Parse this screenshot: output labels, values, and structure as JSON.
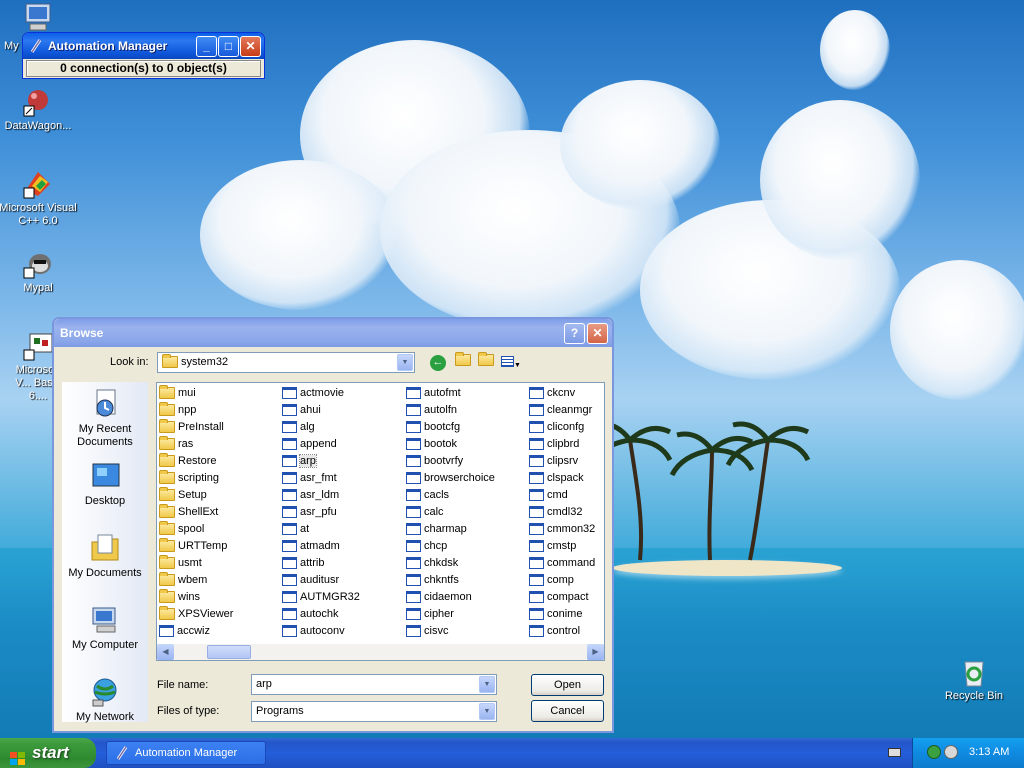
{
  "desktop": {
    "icons": [
      {
        "label": "My",
        "icon": "computer-icon"
      },
      {
        "label": "DataWagon...",
        "icon": "datawagon-icon"
      },
      {
        "label": "Microsoft Visual C++ 6.0",
        "icon": "visual-cpp-icon"
      },
      {
        "label": "Mypal",
        "icon": "mypal-icon"
      },
      {
        "label": "Microsoft V... Basic 6....",
        "icon": "visual-basic-icon"
      },
      {
        "label": "Recycle Bin",
        "icon": "recycle-bin-icon"
      }
    ]
  },
  "automation_manager": {
    "title": "Automation Manager",
    "status": "0 connection(s) to 0 object(s)"
  },
  "browse_dialog": {
    "title": "Browse",
    "look_in_label": "Look in:",
    "look_in_value": "system32",
    "places": [
      "My Recent Documents",
      "Desktop",
      "My Documents",
      "My Computer",
      "My Network"
    ],
    "columns": [
      [
        {
          "name": "mui",
          "type": "folder"
        },
        {
          "name": "npp",
          "type": "folder"
        },
        {
          "name": "PreInstall",
          "type": "folder"
        },
        {
          "name": "ras",
          "type": "folder"
        },
        {
          "name": "Restore",
          "type": "folder"
        },
        {
          "name": "scripting",
          "type": "folder"
        },
        {
          "name": "Setup",
          "type": "folder"
        },
        {
          "name": "ShellExt",
          "type": "folder"
        },
        {
          "name": "spool",
          "type": "folder"
        },
        {
          "name": "URTTemp",
          "type": "folder"
        },
        {
          "name": "usmt",
          "type": "folder"
        },
        {
          "name": "wbem",
          "type": "folder"
        },
        {
          "name": "wins",
          "type": "folder"
        },
        {
          "name": "XPSViewer",
          "type": "folder"
        },
        {
          "name": "accwiz",
          "type": "exe"
        }
      ],
      [
        {
          "name": "actmovie",
          "type": "exe"
        },
        {
          "name": "ahui",
          "type": "exe"
        },
        {
          "name": "alg",
          "type": "exe"
        },
        {
          "name": "append",
          "type": "exe"
        },
        {
          "name": "arp",
          "type": "exe"
        },
        {
          "name": "asr_fmt",
          "type": "exe"
        },
        {
          "name": "asr_ldm",
          "type": "exe"
        },
        {
          "name": "asr_pfu",
          "type": "exe"
        },
        {
          "name": "at",
          "type": "exe"
        },
        {
          "name": "atmadm",
          "type": "exe"
        },
        {
          "name": "attrib",
          "type": "exe"
        },
        {
          "name": "auditusr",
          "type": "exe"
        },
        {
          "name": "AUTMGR32",
          "type": "exe"
        },
        {
          "name": "autochk",
          "type": "exe"
        },
        {
          "name": "autoconv",
          "type": "exe"
        }
      ],
      [
        {
          "name": "autofmt",
          "type": "exe"
        },
        {
          "name": "autolfn",
          "type": "exe"
        },
        {
          "name": "bootcfg",
          "type": "exe"
        },
        {
          "name": "bootok",
          "type": "exe"
        },
        {
          "name": "bootvrfy",
          "type": "exe"
        },
        {
          "name": "browserchoice",
          "type": "exe"
        },
        {
          "name": "cacls",
          "type": "exe"
        },
        {
          "name": "calc",
          "type": "exe"
        },
        {
          "name": "charmap",
          "type": "exe"
        },
        {
          "name": "chcp",
          "type": "exe"
        },
        {
          "name": "chkdsk",
          "type": "exe"
        },
        {
          "name": "chkntfs",
          "type": "exe"
        },
        {
          "name": "cidaemon",
          "type": "exe"
        },
        {
          "name": "cipher",
          "type": "exe"
        },
        {
          "name": "cisvc",
          "type": "exe"
        }
      ],
      [
        {
          "name": "ckcnv",
          "type": "exe"
        },
        {
          "name": "cleanmgr",
          "type": "exe"
        },
        {
          "name": "cliconfg",
          "type": "exe"
        },
        {
          "name": "clipbrd",
          "type": "exe"
        },
        {
          "name": "clipsrv",
          "type": "exe"
        },
        {
          "name": "clspack",
          "type": "exe"
        },
        {
          "name": "cmd",
          "type": "exe"
        },
        {
          "name": "cmdl32",
          "type": "exe"
        },
        {
          "name": "cmmon32",
          "type": "exe"
        },
        {
          "name": "cmstp",
          "type": "exe"
        },
        {
          "name": "command",
          "type": "exe"
        },
        {
          "name": "comp",
          "type": "exe"
        },
        {
          "name": "compact",
          "type": "exe"
        },
        {
          "name": "conime",
          "type": "exe"
        },
        {
          "name": "control",
          "type": "exe"
        }
      ]
    ],
    "selected": "arp",
    "file_name_label": "File name:",
    "file_name_value": "arp",
    "files_of_type_label": "Files of type:",
    "files_of_type_value": "Programs",
    "open_label": "Open",
    "cancel_label": "Cancel"
  },
  "taskbar": {
    "start_label": "start",
    "task_label": "Automation Manager",
    "clock": "3:13 AM"
  }
}
